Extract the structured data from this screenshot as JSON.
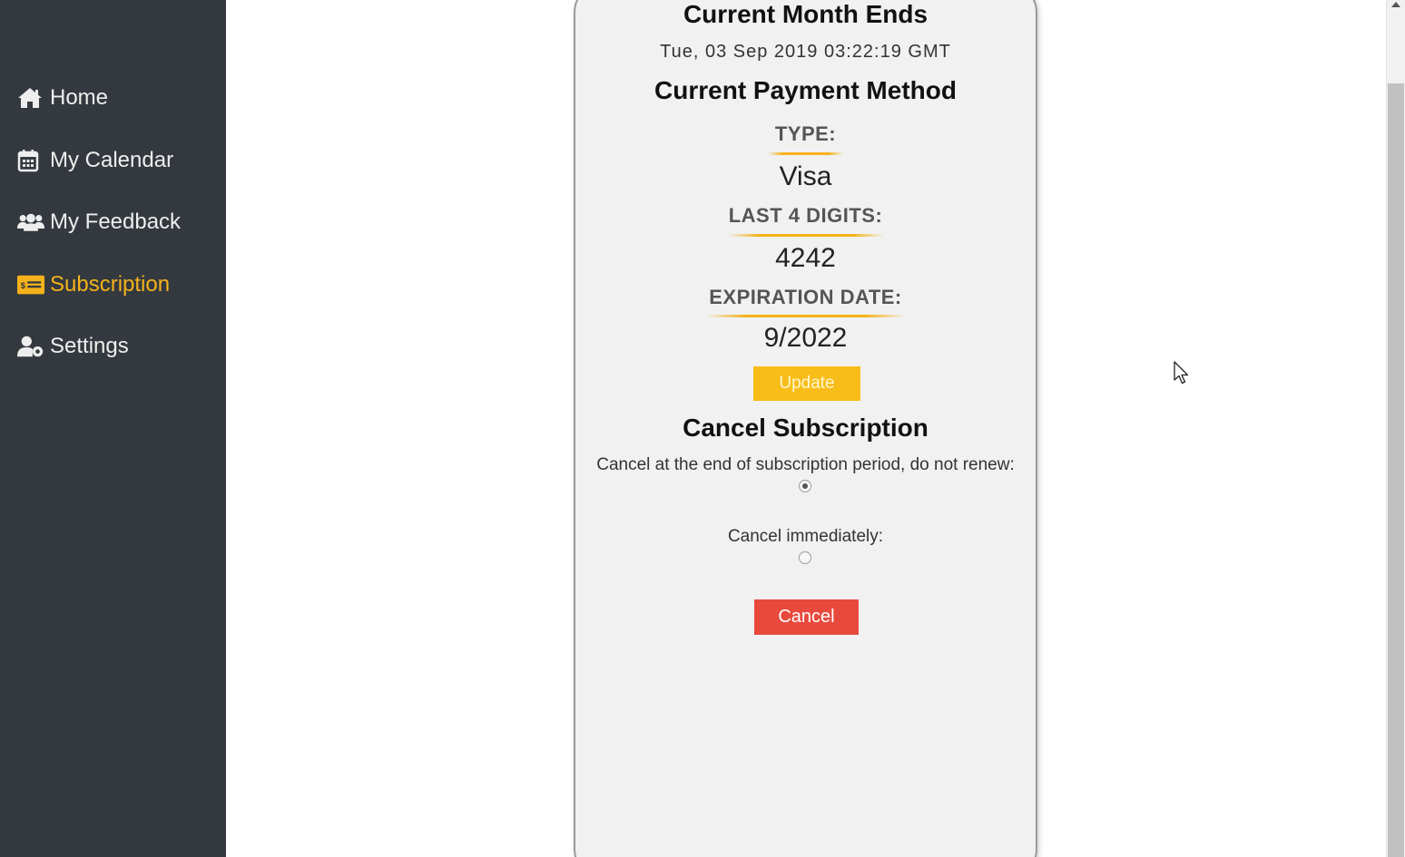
{
  "sidebar": {
    "items": [
      {
        "label": "Home",
        "icon": "home-icon"
      },
      {
        "label": "My Calendar",
        "icon": "calendar-icon"
      },
      {
        "label": "My Feedback",
        "icon": "users-icon"
      },
      {
        "label": "Subscription",
        "icon": "subscription-card-icon",
        "active": true
      },
      {
        "label": "Settings",
        "icon": "user-gear-icon"
      }
    ]
  },
  "card": {
    "period_title": "Current Month Ends",
    "period_end": "Tue, 03 Sep 2019 03:22:19 GMT",
    "payment_title": "Current Payment Method",
    "type_label": "TYPE:",
    "type_value": "Visa",
    "digits_label": "LAST 4 DIGITS:",
    "digits_value": "4242",
    "expiration_label": "EXPIRATION DATE:",
    "expiration_value": "9/2022",
    "update_label": "Update",
    "cancel_title": "Cancel Subscription",
    "option_end_label": "Cancel at the end of subscription period, do not renew:",
    "option_end_checked": true,
    "option_now_label": "Cancel immediately:",
    "option_now_checked": false,
    "cancel_label": "Cancel"
  },
  "colors": {
    "sidebar_bg": "#33393f",
    "accent": "#f5b21b",
    "update_button": "#f9bd1a",
    "cancel_button": "#e8493d",
    "card_bg": "#f1f1f1"
  }
}
